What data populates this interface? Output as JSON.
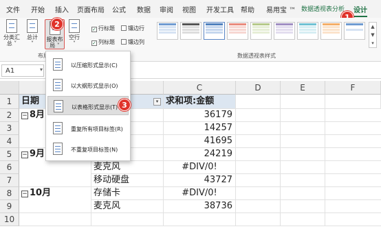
{
  "tabs": [
    "文件",
    "开始",
    "插入",
    "页面布局",
    "公式",
    "数据",
    "审阅",
    "视图",
    "开发工具",
    "帮助",
    "易用宝 ™",
    "数据透视表分析",
    "设计"
  ],
  "ribbon": {
    "subtotal_label": "分类汇\n总 ˅",
    "grandtotal_label": "总计\n˅",
    "report_layout_label": "报表布\n局 ˅",
    "blank_rows_label": "空行\n˅",
    "layout_group_label": "布局",
    "checkboxes": [
      {
        "label": "行标题",
        "checked": true
      },
      {
        "label": "镶边行",
        "checked": false
      },
      {
        "label": "列标题",
        "checked": true
      },
      {
        "label": "镶边列",
        "checked": false
      }
    ],
    "styles_group_label": "数据透视表样式"
  },
  "formula_bar": {
    "name_box": "A1"
  },
  "menu": {
    "items": [
      "以压缩形式显示(C)",
      "以大纲形式显示(O)",
      "以表格形式显示(T)",
      "重复所有项目标签(R)",
      "不重复项目标签(N)"
    ]
  },
  "badges": [
    "1",
    "2",
    "3"
  ],
  "grid": {
    "columns": [
      "A",
      "B",
      "C",
      "D",
      "E",
      "F"
    ],
    "rows": [
      "1",
      "2",
      "3",
      "4",
      "5",
      "6",
      "7",
      "8",
      "9",
      "10"
    ],
    "a1": "日期",
    "c1": "求和项:金额",
    "a2": "8月",
    "a5": "9月",
    "a8": "10月",
    "b6": "麦克风",
    "b7": "移动硬盘",
    "b8": "存储卡",
    "b9": "麦克风",
    "c_values": [
      "36179",
      "14257",
      "41695",
      "24219",
      "#DIV/0!",
      "43727",
      "#DIV/0!",
      "38736"
    ]
  },
  "colors": {
    "accent": "#217346",
    "badge": "#e0332b",
    "header_fill": "#dce6f1"
  }
}
